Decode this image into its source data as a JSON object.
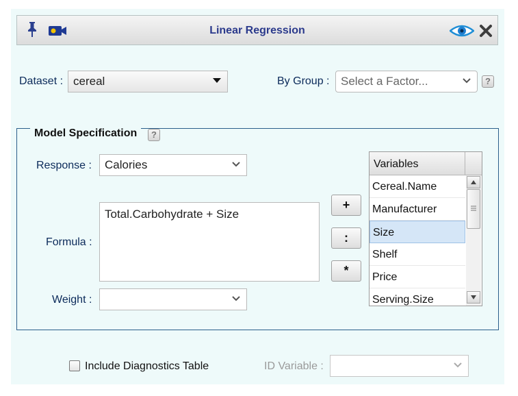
{
  "window": {
    "title": "Linear Regression",
    "icons": [
      "pin-icon",
      "video-camera-icon",
      "eye-icon",
      "close-icon"
    ]
  },
  "dataset": {
    "label": "Dataset :",
    "value": "cereal"
  },
  "by_group": {
    "label": "By Group :",
    "placeholder": "Select a Factor...",
    "help": "?"
  },
  "model": {
    "legend": "Model Specification",
    "help": "?",
    "response": {
      "label": "Response :",
      "value": "Calories"
    },
    "formula": {
      "label": "Formula :",
      "value": "Total.Carbohydrate + Size"
    },
    "weight": {
      "label": "Weight :",
      "value": ""
    },
    "operators": [
      "+",
      ":",
      "*"
    ],
    "variables": {
      "header": "Variables",
      "items": [
        "Cereal.Name",
        "Manufacturer",
        "Size",
        "Shelf",
        "Price",
        "Serving.Size"
      ],
      "selected": "Size"
    }
  },
  "diagnostics": {
    "label": "Include Diagnostics Table",
    "checked": false
  },
  "id_variable": {
    "label": "ID Variable :",
    "value": ""
  },
  "colors": {
    "panel": "#eefafa",
    "title": "#2b3a8c",
    "label": "#0b2a5a",
    "selection": "#d5e6f7"
  }
}
